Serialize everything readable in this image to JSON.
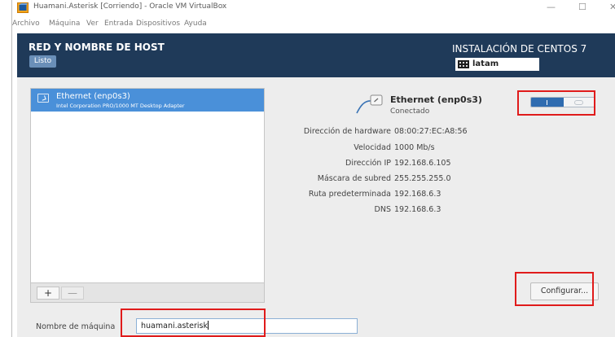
{
  "window": {
    "title": "Huamani.Asterisk [Corriendo] - Oracle VM VirtualBox",
    "minimize": "—",
    "maximize": "☐",
    "close": "✕"
  },
  "menu": [
    "Archivo",
    "Máquina",
    "Ver",
    "Entrada",
    "Dispositivos",
    "Ayuda"
  ],
  "header": {
    "title": "RED Y NOMBRE DE HOST",
    "done_label": "Listo",
    "installer_title": "INSTALACIÓN DE CENTOS 7",
    "keyboard_layout": "latam"
  },
  "devices": {
    "items": [
      {
        "name": "Ethernet (enp0s3)",
        "description": "Intel Corporation PRO/1000 MT Desktop Adapter"
      }
    ],
    "add_label": "+",
    "remove_label": "—"
  },
  "detail": {
    "name": "Ethernet (enp0s3)",
    "status": "Conectado",
    "toggle_on": true,
    "properties": [
      {
        "label": "Dirección de hardware",
        "value": "08:00:27:EC:A8:56"
      },
      {
        "label": "Velocidad",
        "value": "1000 Mb/s"
      },
      {
        "label": "Dirección IP",
        "value": "192.168.6.105"
      },
      {
        "label": "Máscara de subred",
        "value": "255.255.255.0"
      },
      {
        "label": "Ruta predeterminada",
        "value": "192.168.6.3"
      },
      {
        "label": "DNS",
        "value": "192.168.6.3"
      }
    ],
    "configure_label": "Configurar..."
  },
  "hostname": {
    "label": "Nombre de máquina",
    "value": "huamani.asterisk"
  },
  "colors": {
    "header_bg": "#1f3a59",
    "selection": "#4a90d9",
    "toggle_on": "#2f6cb0",
    "annotation": "#e01b1b"
  }
}
